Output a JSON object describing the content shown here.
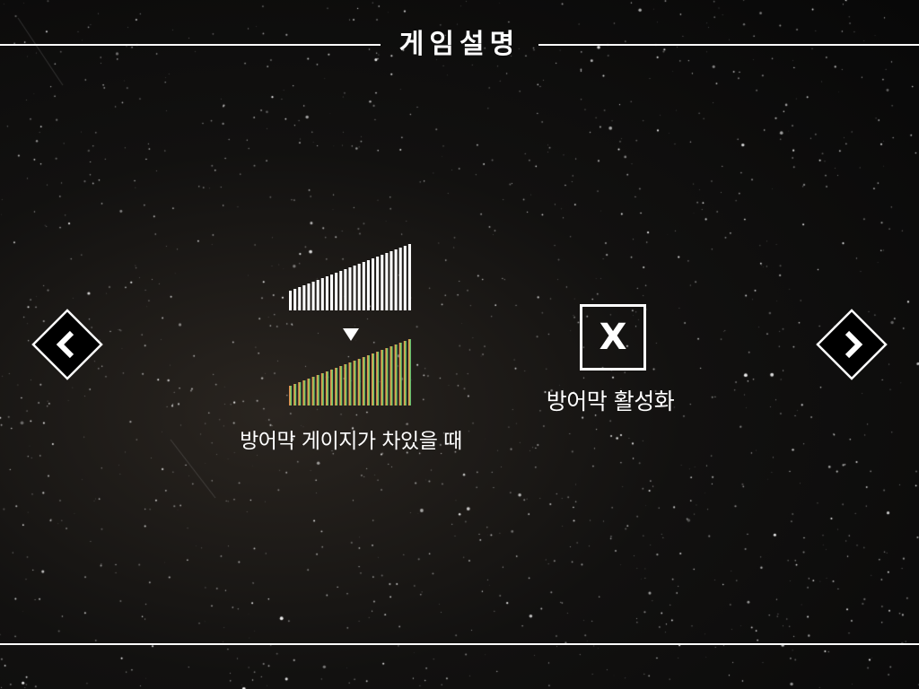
{
  "header": {
    "title": "게임설명"
  },
  "navigation": {
    "prev_icon": "chevron-left-icon",
    "next_icon": "chevron-right-icon"
  },
  "gauge": {
    "full_state_color": "#ffffff",
    "active_gradient_colors": [
      "#e8735a",
      "#d6b04a",
      "#8ac45a",
      "#4fbf85"
    ],
    "caption": "방어막 게이지가 차있을 때"
  },
  "shield": {
    "key_label": "X",
    "caption": "방어막 활성화"
  }
}
